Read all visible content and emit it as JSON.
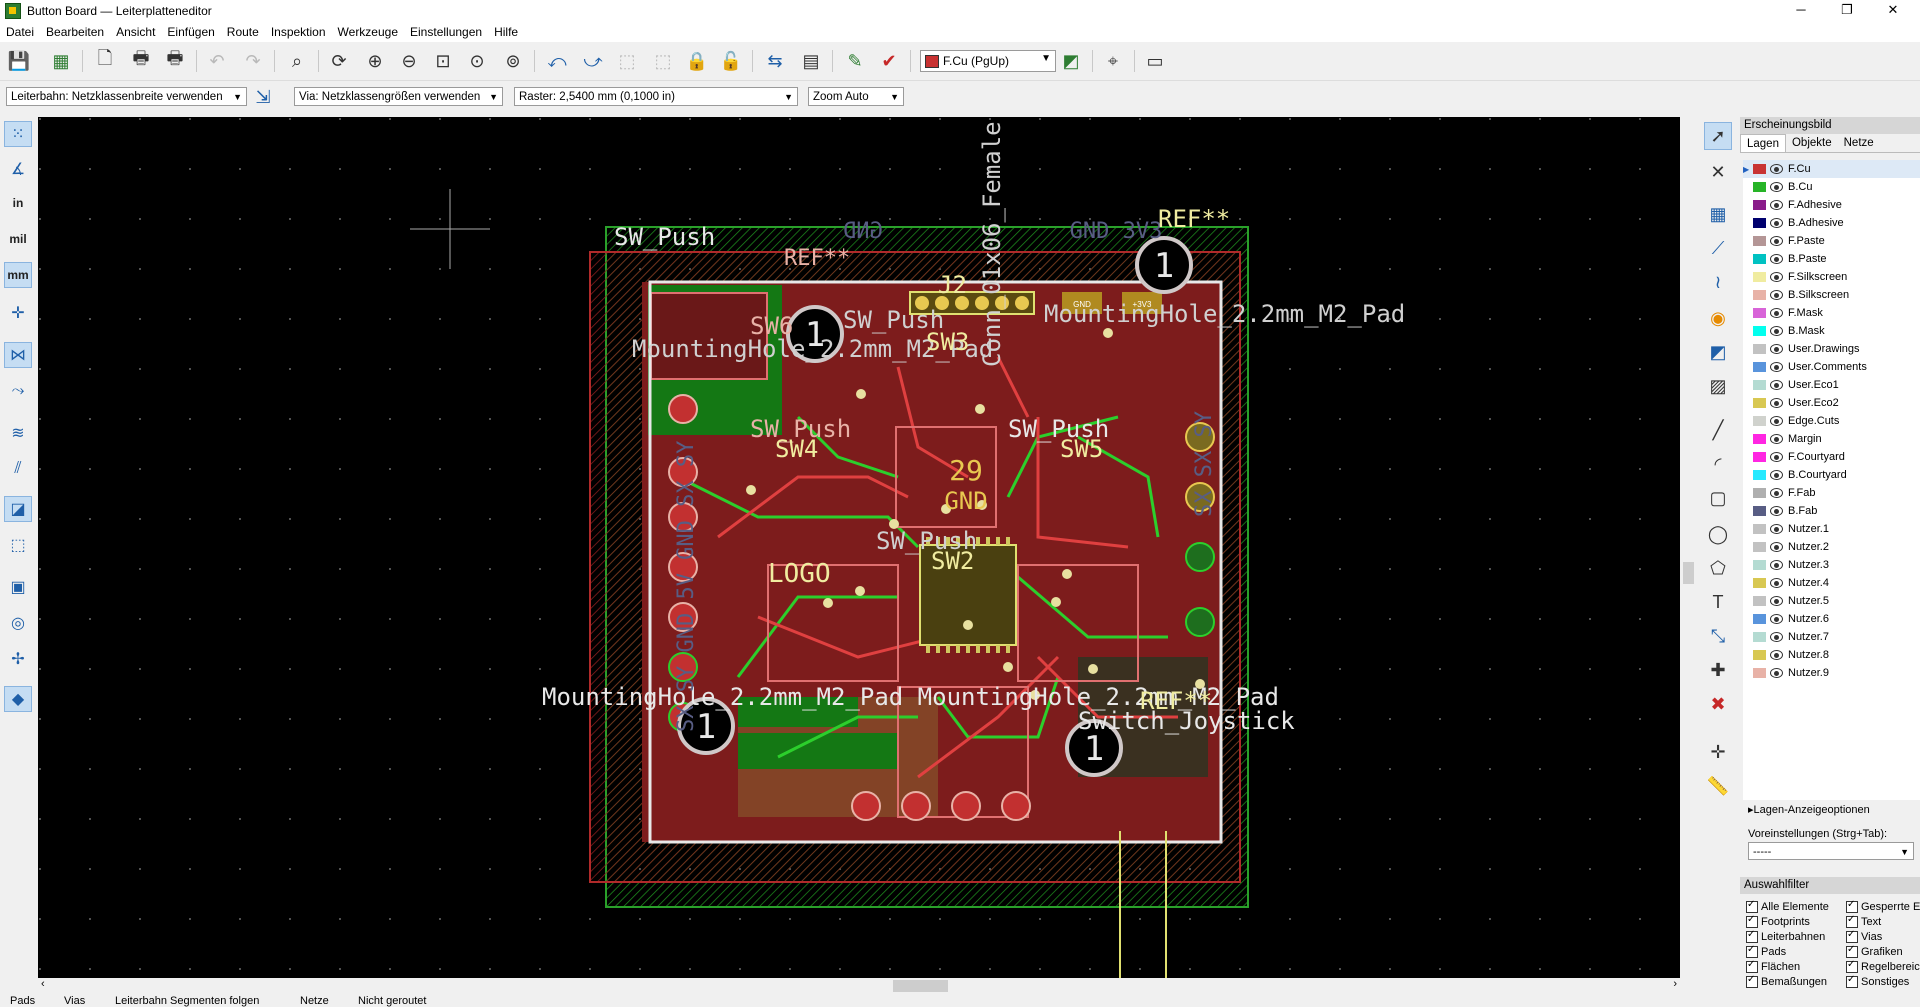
{
  "window": {
    "title": "Button Board — Leiterplatteneditor",
    "minimize": "─",
    "maximize": "❐",
    "close": "✕"
  },
  "menu": [
    "Datei",
    "Bearbeiten",
    "Ansicht",
    "Einfügen",
    "Route",
    "Inspektion",
    "Werkzeuge",
    "Einstellungen",
    "Hilfe"
  ],
  "toolbar": {
    "active_layer": "F.Cu (PgUp)"
  },
  "toolbar2": {
    "track": "Leiterbahn: Netzklassenbreite verwenden",
    "via": "Via: Netzklassengrößen verwenden",
    "grid": "Raster: 2,5400 mm (0,1000 in)",
    "zoom": "Zoom Auto"
  },
  "left_toolbar": {
    "units_in": "in",
    "units_mil": "mil",
    "units_mm": "mm"
  },
  "board_text": {
    "sw_push_top": "SW_Push",
    "gnd_mirror": "GND",
    "gnd_3v3_mirror": "GND 3V3",
    "ref_top_right": "REF**",
    "ref_top_left": "REF**",
    "j2": "J2",
    "conn_vertical": "Conn_01x06_Female",
    "mh_pad_right": "MountingHole_2.2mm_M2_Pad",
    "mh_pad_left": "MountingHole_2.2mm_M2_Pad",
    "sw_push_mid": "SW_Push",
    "sw3": "SW3",
    "sw6": "SW6",
    "sw4": "SW4",
    "sw_push_left": "SW_Push",
    "sw_push_right": "SW_Push",
    "sw5": "SW5",
    "num29": "29",
    "gnd_center": "GND",
    "sw_push_bottom": "SW_Push",
    "sw2": "SW2",
    "logo": "LOGO",
    "mh_pad_bottom": "MountingHole_2.2mm_M2_Pad MountingHole_2.2mm_M2_Pad",
    "ref_bottom": "REF**",
    "switch_joystick": "Switch_Joystick",
    "hole_label": "1",
    "pad_gnd": "GND",
    "pad_3v3": "+3V3",
    "vertical_left": "SX SY GND 5V GND SX SY",
    "vertical_right": "SX SX SY"
  },
  "panel": {
    "title": "Erscheinungsbild",
    "tabs": [
      "Lagen",
      "Objekte",
      "Netze"
    ],
    "layers": [
      {
        "name": "F.Cu",
        "color": "#c83434"
      },
      {
        "name": "B.Cu",
        "color": "#27b427"
      },
      {
        "name": "F.Adhesive",
        "color": "#8a1c8a"
      },
      {
        "name": "B.Adhesive",
        "color": "#00006e"
      },
      {
        "name": "F.Paste",
        "color": "#b49696"
      },
      {
        "name": "B.Paste",
        "color": "#00c2c2"
      },
      {
        "name": "F.Silkscreen",
        "color": "#f0eca0"
      },
      {
        "name": "B.Silkscreen",
        "color": "#e8b2a7"
      },
      {
        "name": "F.Mask",
        "color": "#d864d8"
      },
      {
        "name": "B.Mask",
        "color": "#02ffee"
      },
      {
        "name": "User.Drawings",
        "color": "#c2c2c2"
      },
      {
        "name": "User.Comments",
        "color": "#5994dc"
      },
      {
        "name": "User.Eco1",
        "color": "#b4dbd2"
      },
      {
        "name": "User.Eco2",
        "color": "#d8c852"
      },
      {
        "name": "Edge.Cuts",
        "color": "#d0d2cd"
      },
      {
        "name": "Margin",
        "color": "#ff26e2"
      },
      {
        "name": "F.Courtyard",
        "color": "#ff26e2"
      },
      {
        "name": "B.Courtyard",
        "color": "#26e9ff"
      },
      {
        "name": "F.Fab",
        "color": "#afafaf"
      },
      {
        "name": "B.Fab",
        "color": "#585d84"
      },
      {
        "name": "Nutzer.1",
        "color": "#c2c2c2"
      },
      {
        "name": "Nutzer.2",
        "color": "#c2c2c2"
      },
      {
        "name": "Nutzer.3",
        "color": "#b4dbd2"
      },
      {
        "name": "Nutzer.4",
        "color": "#d8c852"
      },
      {
        "name": "Nutzer.5",
        "color": "#c2c2c2"
      },
      {
        "name": "Nutzer.6",
        "color": "#5994dc"
      },
      {
        "name": "Nutzer.7",
        "color": "#b4dbd2"
      },
      {
        "name": "Nutzer.8",
        "color": "#d8c852"
      },
      {
        "name": "Nutzer.9",
        "color": "#e8b2a7"
      }
    ],
    "layer_options": "Lagen-Anzeigeoptionen",
    "presets_label": "Voreinstellungen (Strg+Tab):",
    "preset_value": "-----",
    "selection_filter": "Auswahlfilter",
    "filters": [
      "Alle Elemente",
      "Gesperrte Elemente",
      "Footprints",
      "Text",
      "Leiterbahnen",
      "Vias",
      "Pads",
      "Grafiken",
      "Flächen",
      "Regelbereiche",
      "Bemaßungen",
      "Sonstiges"
    ]
  },
  "status": [
    "Pads",
    "Vias",
    "Leiterbahn Segmenten folgen",
    "Netze",
    "Nicht geroutet"
  ]
}
